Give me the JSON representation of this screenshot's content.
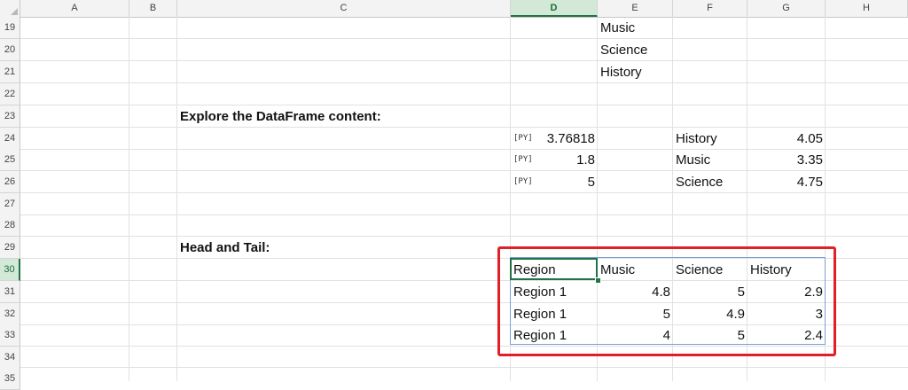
{
  "sheet": {
    "columns": [
      "A",
      "B",
      "C",
      "D",
      "E",
      "F",
      "G",
      "H"
    ],
    "active_column": "D",
    "rows": [
      "19",
      "20",
      "21",
      "22",
      "23",
      "24",
      "25",
      "26",
      "27",
      "28",
      "29",
      "30",
      "31",
      "32",
      "33",
      "34",
      "35"
    ],
    "active_row": "30"
  },
  "cells": {
    "E19": "Music",
    "E20": "Science",
    "E21": "History",
    "C23": "Explore the DataFrame content:",
    "D24": "3.76818",
    "D25": "1.8",
    "D26": "5",
    "F24": "History",
    "F25": "Music",
    "F26": "Science",
    "G24": "4.05",
    "G25": "3.35",
    "G26": "4.75",
    "C29": "Head and Tail:"
  },
  "py_icon_label": "[PY]",
  "table": {
    "headers": [
      "Region",
      "Music",
      "Science",
      "History"
    ],
    "rows": [
      [
        "Region 1",
        "4.8",
        "5",
        "2.9"
      ],
      [
        "Region 1",
        "5",
        "4.9",
        "3"
      ],
      [
        "Region 1",
        "4",
        "5",
        "2.4"
      ]
    ]
  },
  "highlight_color": "#e01f26",
  "accent_color": "#217346"
}
